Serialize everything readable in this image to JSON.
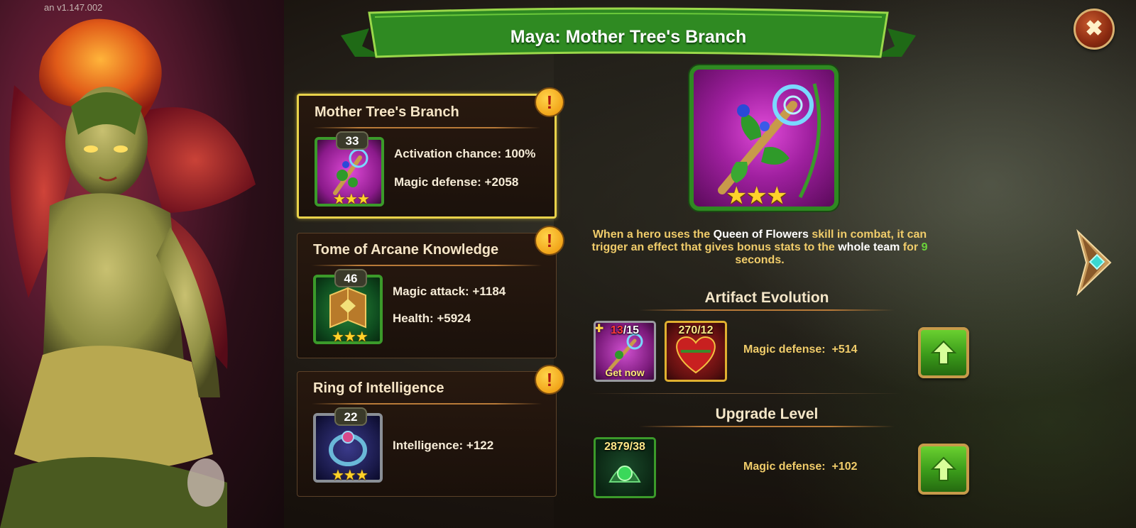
{
  "version": "an v1.147.002",
  "title": "Maya: Mother Tree's Branch",
  "artifacts": [
    {
      "name": "Mother Tree's Branch",
      "level": "33",
      "stars": "★★★",
      "stats": [
        "Activation chance: 100%",
        "Magic defense: +2058"
      ]
    },
    {
      "name": "Tome of Arcane Knowledge",
      "level": "46",
      "stars": "★★★",
      "stats": [
        "Magic attack: +1184",
        "Health: +5924"
      ]
    },
    {
      "name": "Ring of Intelligence",
      "level": "22",
      "stars": "★★★",
      "stats": [
        "Intelligence: +122"
      ]
    }
  ],
  "detail": {
    "stars": "★★★",
    "description": {
      "p1": "When a hero uses the ",
      "skill": "Queen of Flowers",
      "p2": " skill in combat, it can trigger an effect that gives bonus stats to the ",
      "target": "whole team",
      "p3": " for ",
      "seconds": "9",
      "p4": " seconds."
    },
    "evolution": {
      "title": "Artifact Evolution",
      "fragments_have": "13",
      "fragments_need": "/15",
      "get_now": "Get now",
      "resource_count": "270/12",
      "bonus_label": "Magic defense:",
      "bonus_value": "+514"
    },
    "upgrade": {
      "title": "Upgrade Level",
      "resource_count": "2879/38",
      "bonus_label": "Magic defense:",
      "bonus_value": "+102"
    }
  },
  "icons": {
    "close": "close-icon",
    "alert": "exclamation-icon",
    "upgrade": "arrow-up-icon",
    "next": "chevron-right-icon",
    "puzzle": "puzzle-piece-icon"
  },
  "colors": {
    "banner_green": "#2f8a22",
    "highlight_yellow": "#e9d24a",
    "text_gold": "#f0cc6a",
    "accent_green": "#6ad43a",
    "fragment_red": "#ff3a3a"
  }
}
